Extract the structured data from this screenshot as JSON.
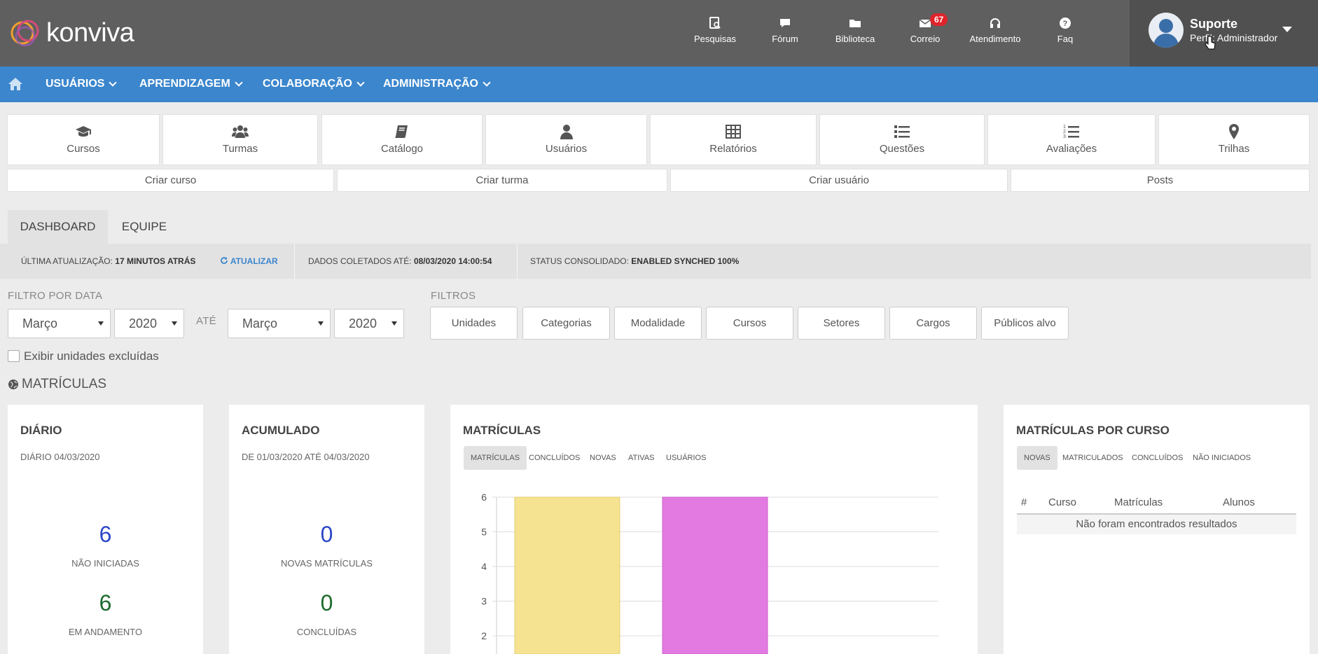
{
  "brand": {
    "name": "konviva"
  },
  "topbar": {
    "items": [
      {
        "label": "Pesquisas",
        "icon": "survey-icon"
      },
      {
        "label": "Fórum",
        "icon": "chat-bubble-icon"
      },
      {
        "label": "Biblioteca",
        "icon": "folder-icon"
      },
      {
        "label": "Correio",
        "icon": "envelope-icon",
        "badge": "67"
      },
      {
        "label": "Atendimento",
        "icon": "headset-icon"
      },
      {
        "label": "Faq",
        "icon": "question-circle-icon"
      }
    ],
    "user": {
      "name": "Suporte",
      "role": "Perfil: Administrador"
    }
  },
  "nav": {
    "items": [
      {
        "label": "USUÁRIOS"
      },
      {
        "label": "APRENDIZAGEM"
      },
      {
        "label": "COLABORAÇÃO"
      },
      {
        "label": "ADMINISTRAÇÃO"
      }
    ]
  },
  "shortcuts": [
    {
      "label": "Cursos",
      "icon": "graduation-cap-icon"
    },
    {
      "label": "Turmas",
      "icon": "users-group-icon"
    },
    {
      "label": "Catálogo",
      "icon": "book-icon"
    },
    {
      "label": "Usuários",
      "icon": "user-icon"
    },
    {
      "label": "Relatórios",
      "icon": "table-icon"
    },
    {
      "label": "Questões",
      "icon": "list-icon"
    },
    {
      "label": "Avaliações",
      "icon": "ordered-list-icon"
    },
    {
      "label": "Trilhas",
      "icon": "map-marker-icon"
    }
  ],
  "actions": [
    {
      "label": "Criar curso"
    },
    {
      "label": "Criar turma"
    },
    {
      "label": "Criar usuário"
    },
    {
      "label": "Posts"
    }
  ],
  "tabs": [
    {
      "label": "DASHBOARD",
      "active": true
    },
    {
      "label": "EQUIPE",
      "active": false
    }
  ],
  "status": {
    "last_update_label": "ÚLTIMA ATUALIZAÇÃO:",
    "last_update_value": "17 MINUTOS ATRÁS",
    "refresh_label": "ATUALIZAR",
    "collected_label": "DADOS COLETADOS ATÉ:",
    "collected_value": "08/03/2020 14:00:54",
    "consolidated_label": "STATUS CONSOLIDADO:",
    "consolidated_value": "ENABLED SYNCHED 100%"
  },
  "filters": {
    "date_label": "FILTRO POR DATA",
    "from_month": "Março",
    "from_year": "2020",
    "until_label": "ATÉ",
    "to_month": "Março",
    "to_year": "2020",
    "filters_label": "FILTROS",
    "buttons": [
      "Unidades",
      "Categorias",
      "Modalidade",
      "Cursos",
      "Setores",
      "Cargos",
      "Públicos alvo"
    ],
    "show_excluded_label": "Exibir unidades excluídas"
  },
  "section": {
    "title": "MATRÍCULAS"
  },
  "cards": {
    "diario": {
      "title": "DIÁRIO",
      "subtitle": "DIÁRIO 04/03/2020",
      "not_started_value": "6",
      "not_started_label": "NÃO INICIADAS",
      "in_progress_value": "6",
      "in_progress_label": "EM ANDAMENTO"
    },
    "acumulado": {
      "title": "ACUMULADO",
      "subtitle": "DE 01/03/2020 ATÉ 04/03/2020",
      "new_value": "0",
      "new_label": "NOVAS MATRÍCULAS",
      "done_value": "0",
      "done_label": "CONCLUÍDAS"
    },
    "matriculas": {
      "title": "MATRÍCULAS",
      "tabs": [
        "MATRÍCULAS",
        "CONCLUÍDOS",
        "NOVAS",
        "ATIVAS",
        "USUÁRIOS"
      ]
    },
    "por_curso": {
      "title": "MATRÍCULAS POR CURSO",
      "tabs": [
        "NOVAS",
        "MATRICULADOS",
        "CONCLUÍDOS",
        "NÃO INICIADOS"
      ],
      "columns": [
        "#",
        "Curso",
        "Matrículas",
        "Alunos"
      ],
      "empty_text": "Não foram encontrados resultados"
    }
  },
  "chart_data": {
    "type": "bar",
    "categories": [
      "",
      ""
    ],
    "values": [
      6,
      6
    ],
    "colors": [
      "#f6e391",
      "#e27ae2"
    ],
    "yticks": [
      6,
      5,
      4,
      3,
      2
    ],
    "ylim": [
      2,
      6
    ],
    "grid": true
  }
}
